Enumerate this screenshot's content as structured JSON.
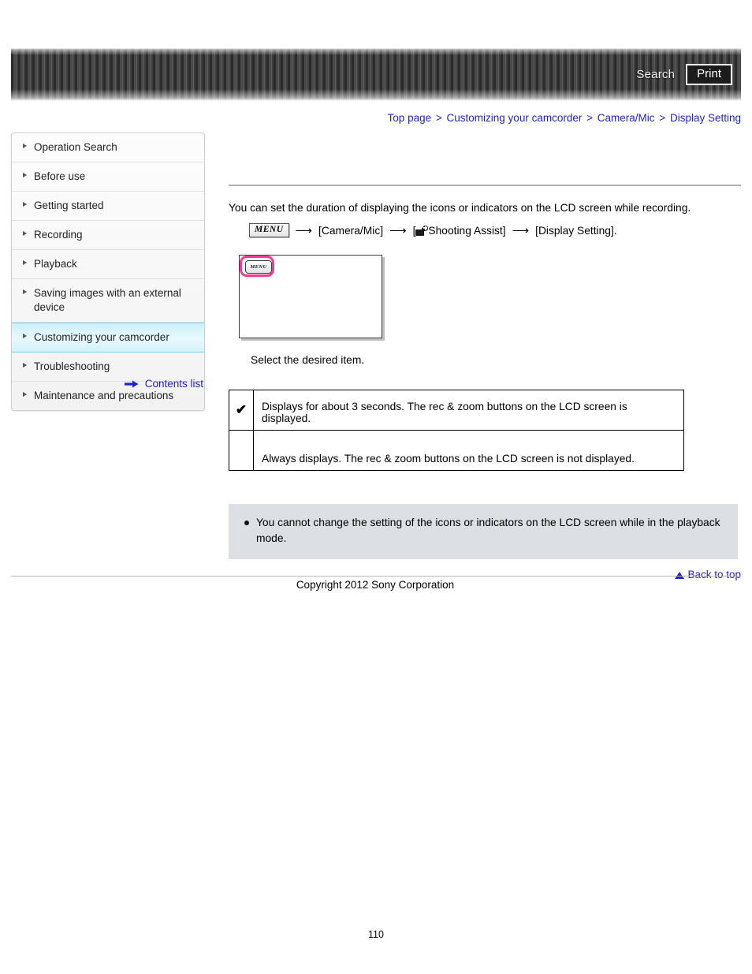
{
  "header": {
    "search_label": "Search",
    "print_label": "Print"
  },
  "breadcrumb": {
    "items": [
      {
        "label": "Top page"
      },
      {
        "label": "Customizing your camcorder"
      },
      {
        "label": "Camera/Mic"
      },
      {
        "label": "Display Setting"
      }
    ],
    "separator": ">"
  },
  "sidebar": {
    "items": [
      {
        "label": "Operation Search",
        "active": false
      },
      {
        "label": "Before use",
        "active": false
      },
      {
        "label": "Getting started",
        "active": false
      },
      {
        "label": "Recording",
        "active": false
      },
      {
        "label": "Playback",
        "active": false
      },
      {
        "label": "Saving images with an external device",
        "active": false
      },
      {
        "label": "Customizing your camcorder",
        "active": true
      },
      {
        "label": "Troubleshooting",
        "active": false
      },
      {
        "label": "Maintenance and precautions",
        "active": false
      }
    ],
    "contents_list_label": "Contents list"
  },
  "main": {
    "intro": "You can set the duration of displaying the icons or indicators on the LCD screen while recording.",
    "menu_path": {
      "menu_chip": "MENU",
      "arrow": "⟶",
      "step1": "[Camera/Mic]",
      "step2_prefix": "[",
      "step2": "Shooting Assist]",
      "step3": "[Display Setting]."
    },
    "lcd_figure": {
      "menu_button_label": "MENU"
    },
    "select_caption": "Select the desired item.",
    "options_table": {
      "rows": [
        {
          "mark": "✔",
          "description": "Displays for about 3 seconds. The rec & zoom buttons on the LCD screen is displayed."
        },
        {
          "mark": "",
          "description": "Always displays. The rec & zoom buttons on the LCD screen is not displayed."
        }
      ]
    },
    "note_box": {
      "notes": [
        "You cannot change the setting of the icons or indicators on the LCD screen while in the playback mode."
      ]
    },
    "back_to_top_label": "Back to top"
  },
  "footer": {
    "copyright": "Copyright 2012 Sony Corporation",
    "page_number": "110"
  },
  "colors": {
    "link": "#2222cc",
    "highlight_pink": "#ef3b96",
    "sidebar_active": "#cdf0fb",
    "note_background": "#dcdfe4",
    "banner_dark": "#3a3a3a"
  }
}
